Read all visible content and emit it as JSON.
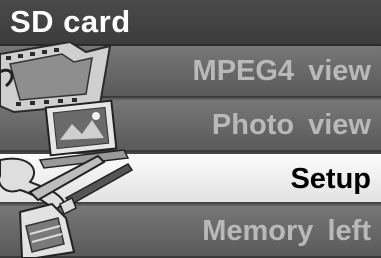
{
  "title": "SD card",
  "menu": {
    "items": [
      {
        "label": "MPEG4 view",
        "selected": false
      },
      {
        "label": "Photo view",
        "selected": false
      },
      {
        "label": "Setup",
        "selected": true
      },
      {
        "label": "Memory left",
        "selected": false
      }
    ]
  },
  "icons": [
    "film-strip-icon",
    "photo-icon",
    "tools-icon",
    "sd-card-icon"
  ],
  "colors": {
    "background": "#5f5f5f",
    "title_bar": "#3c3c3c",
    "selected_row": "#f0f0f0",
    "label_text": "#b9b9b9",
    "selected_text": "#000000"
  }
}
